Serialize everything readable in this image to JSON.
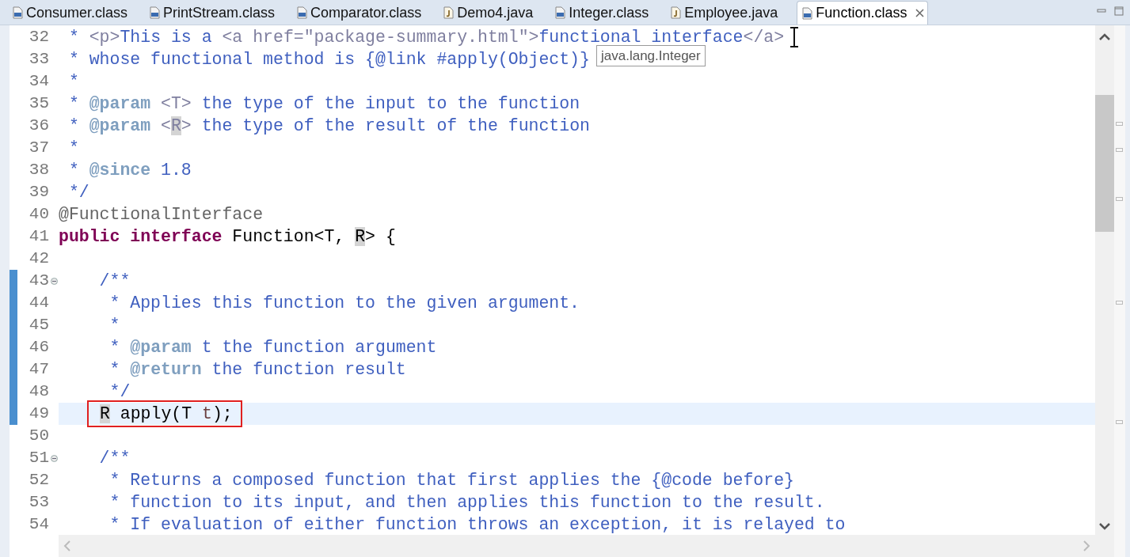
{
  "tabs": [
    {
      "label": "Consumer.class",
      "kind": "class",
      "selected": false
    },
    {
      "label": "PrintStream.class",
      "kind": "class",
      "selected": false
    },
    {
      "label": "Comparator.class",
      "kind": "class",
      "selected": false
    },
    {
      "label": "Demo4.java",
      "kind": "java",
      "selected": false
    },
    {
      "label": "Integer.class",
      "kind": "class",
      "selected": false
    },
    {
      "label": "Employee.java",
      "kind": "java",
      "selected": false
    },
    {
      "label": "Function.class",
      "kind": "class",
      "selected": true
    }
  ],
  "editor": {
    "lines": [
      {
        "number": "32",
        "segments": [
          {
            "kind": "comment",
            "text": " * "
          },
          {
            "kind": "tag",
            "text": "<p>"
          },
          {
            "kind": "comment",
            "text": "This is a "
          },
          {
            "kind": "tag",
            "text": "<a href=\"package-summary.html\">"
          },
          {
            "kind": "comment",
            "text": "functional interface"
          },
          {
            "kind": "tag",
            "text": "</a>"
          }
        ]
      },
      {
        "number": "33",
        "segments": [
          {
            "kind": "comment",
            "text": " * whose functional method is {@link #apply(Object)}"
          }
        ]
      },
      {
        "number": "34",
        "segments": [
          {
            "kind": "comment",
            "text": " *"
          }
        ]
      },
      {
        "number": "35",
        "segments": [
          {
            "kind": "comment",
            "text": " * "
          },
          {
            "kind": "doctag",
            "text": "@param"
          },
          {
            "kind": "tag",
            "text": " <T>"
          },
          {
            "kind": "comment",
            "text": " the type of the input to the function"
          }
        ]
      },
      {
        "number": "36",
        "segments": [
          {
            "kind": "comment",
            "text": " * "
          },
          {
            "kind": "doctag",
            "text": "@param"
          },
          {
            "kind": "tag",
            "text": " <"
          },
          {
            "kind": "tag",
            "text": "R",
            "marked": true
          },
          {
            "kind": "tag",
            "text": ">"
          },
          {
            "kind": "comment",
            "text": " the type of the result of the function"
          }
        ]
      },
      {
        "number": "37",
        "segments": [
          {
            "kind": "comment",
            "text": " *"
          }
        ]
      },
      {
        "number": "38",
        "segments": [
          {
            "kind": "comment",
            "text": " * "
          },
          {
            "kind": "doctag",
            "text": "@since"
          },
          {
            "kind": "comment",
            "text": " 1.8"
          }
        ]
      },
      {
        "number": "39",
        "segments": [
          {
            "kind": "comment",
            "text": " */"
          }
        ]
      },
      {
        "number": "40",
        "segments": [
          {
            "kind": "annotation",
            "text": "@FunctionalInterface"
          }
        ]
      },
      {
        "number": "41",
        "segments": [
          {
            "kind": "keyword",
            "text": "public"
          },
          {
            "kind": "keyword",
            "text": " interface"
          },
          {
            "kind": "code",
            "text": " Function<T, "
          },
          {
            "kind": "code",
            "text": "R",
            "marked": true
          },
          {
            "kind": "code",
            "text": "> {"
          }
        ]
      },
      {
        "number": "42"
      },
      {
        "number": "43",
        "fold": true,
        "changed": true,
        "segments": [
          {
            "kind": "comment",
            "text": "    /**"
          }
        ]
      },
      {
        "number": "44",
        "changed": true,
        "segments": [
          {
            "kind": "comment",
            "text": "     * Applies this function to the given argument."
          }
        ]
      },
      {
        "number": "45",
        "changed": true,
        "segments": [
          {
            "kind": "comment",
            "text": "     *"
          }
        ]
      },
      {
        "number": "46",
        "changed": true,
        "segments": [
          {
            "kind": "comment",
            "text": "     * "
          },
          {
            "kind": "doctag",
            "text": "@param"
          },
          {
            "kind": "comment",
            "text": " t the function argument"
          }
        ]
      },
      {
        "number": "47",
        "changed": true,
        "segments": [
          {
            "kind": "comment",
            "text": "     * "
          },
          {
            "kind": "doctag",
            "text": "@return"
          },
          {
            "kind": "comment",
            "text": " the function result"
          }
        ]
      },
      {
        "number": "48",
        "changed": true,
        "segments": [
          {
            "kind": "comment",
            "text": "     */"
          }
        ]
      },
      {
        "number": "49",
        "changed": true,
        "current": true,
        "outlined": true,
        "segments": [
          {
            "kind": "code",
            "text": "R",
            "marked": true
          },
          {
            "kind": "code",
            "text": " apply(T "
          },
          {
            "kind": "param",
            "text": "t"
          },
          {
            "kind": "code",
            "text": ");"
          }
        ]
      },
      {
        "number": "50"
      },
      {
        "number": "51",
        "fold": true,
        "segments": [
          {
            "kind": "comment",
            "text": "    /**"
          }
        ]
      },
      {
        "number": "52",
        "segments": [
          {
            "kind": "comment",
            "text": "     * Returns a composed function that first applies the {@code before}"
          }
        ]
      },
      {
        "number": "53",
        "segments": [
          {
            "kind": "comment",
            "text": "     * function to its input, and then applies this function to the result."
          }
        ]
      },
      {
        "number": "54",
        "segments": [
          {
            "kind": "comment",
            "text": "     * If evaluation of either function throws an exception, it is relayed to"
          }
        ]
      }
    ],
    "tooltip": "java.lang.Integer"
  }
}
